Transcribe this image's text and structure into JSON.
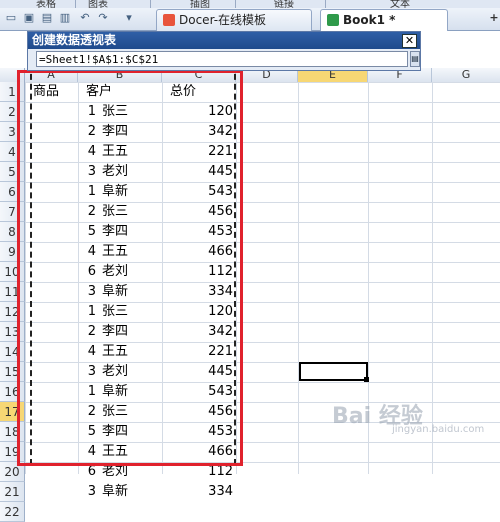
{
  "ribbon": {
    "groups": [
      "表格",
      "图表",
      "插图",
      "链接",
      "文本"
    ]
  },
  "tabs": [
    {
      "label": "Docer-在线模板",
      "active": false
    },
    {
      "label": "Book1 *",
      "active": true
    }
  ],
  "dialog": {
    "title": "创建数据透视表",
    "close_label": "✕",
    "range_value": "=Sheet1!$A$1:$C$21"
  },
  "columns": [
    "A",
    "B",
    "C",
    "D",
    "E",
    "F",
    "G"
  ],
  "rows": [
    "1",
    "2",
    "3",
    "4",
    "5",
    "6",
    "7",
    "8",
    "9",
    "10",
    "11",
    "12",
    "13",
    "14",
    "15",
    "16",
    "17",
    "18",
    "19",
    "20",
    "21",
    "22"
  ],
  "selected_row": "17",
  "table": {
    "headers": [
      "商品",
      "客户",
      "总价"
    ],
    "data": [
      [
        1,
        "张三",
        120
      ],
      [
        2,
        "李四",
        342
      ],
      [
        4,
        "王五",
        221
      ],
      [
        3,
        "老刘",
        445
      ],
      [
        1,
        "阜新",
        543
      ],
      [
        2,
        "张三",
        456
      ],
      [
        5,
        "李四",
        453
      ],
      [
        4,
        "王五",
        466
      ],
      [
        6,
        "老刘",
        112
      ],
      [
        3,
        "阜新",
        334
      ],
      [
        1,
        "张三",
        120
      ],
      [
        2,
        "李四",
        342
      ],
      [
        4,
        "王五",
        221
      ],
      [
        3,
        "老刘",
        445
      ],
      [
        1,
        "阜新",
        543
      ],
      [
        2,
        "张三",
        456
      ],
      [
        5,
        "李四",
        453
      ],
      [
        4,
        "王五",
        466
      ],
      [
        6,
        "老刘",
        112
      ],
      [
        3,
        "阜新",
        334
      ]
    ]
  },
  "watermark": {
    "text": "Bai 经验",
    "sub": "jingyan.baidu.com"
  },
  "colors": {
    "highlight_border": "#e0222d",
    "selected_row_header": "#f7d774"
  }
}
